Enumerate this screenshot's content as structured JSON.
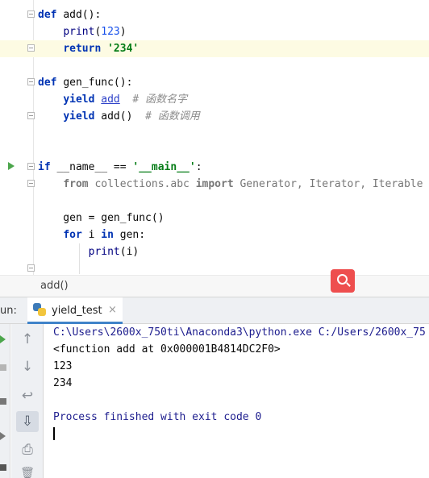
{
  "editor": {
    "lines": [
      [
        {
          "t": "def ",
          "c": "kw"
        },
        {
          "t": "add():",
          "c": ""
        }
      ],
      [
        {
          "t": "    ",
          "c": ""
        },
        {
          "t": "print",
          "c": "bi"
        },
        {
          "t": "(",
          "c": ""
        },
        {
          "t": "123",
          "c": "num"
        },
        {
          "t": ")",
          "c": ""
        }
      ],
      [
        {
          "t": "    ",
          "c": ""
        },
        {
          "t": "return ",
          "c": "kw"
        },
        {
          "t": "'234'",
          "c": "str"
        }
      ],
      [],
      [
        {
          "t": "def ",
          "c": "kw"
        },
        {
          "t": "gen_func():",
          "c": ""
        }
      ],
      [
        {
          "t": "    ",
          "c": ""
        },
        {
          "t": "yield ",
          "c": "kw"
        },
        {
          "t": "add",
          "c": "link"
        },
        {
          "t": "  ",
          "c": ""
        },
        {
          "t": "# 函数名字",
          "c": "cmt"
        }
      ],
      [
        {
          "t": "    ",
          "c": ""
        },
        {
          "t": "yield ",
          "c": "kw"
        },
        {
          "t": "add()  ",
          "c": ""
        },
        {
          "t": "# 函数调用",
          "c": "cmt"
        }
      ],
      [],
      [],
      [
        {
          "t": "if ",
          "c": "kw"
        },
        {
          "t": "__name__ == ",
          "c": ""
        },
        {
          "t": "'__main__'",
          "c": "str"
        },
        {
          "t": ":",
          "c": ""
        }
      ],
      [
        {
          "t": "    ",
          "c": ""
        },
        {
          "t": "from ",
          "c": "kw dim"
        },
        {
          "t": "collections.abc ",
          "c": "dim"
        },
        {
          "t": "import ",
          "c": "kw dim"
        },
        {
          "t": "Generator, Iterator, Iterable",
          "c": "dim"
        }
      ],
      [],
      [
        {
          "t": "    gen = gen_func()",
          "c": ""
        }
      ],
      [
        {
          "t": "    ",
          "c": ""
        },
        {
          "t": "for ",
          "c": "kw"
        },
        {
          "t": "i ",
          "c": ""
        },
        {
          "t": "in ",
          "c": "kw"
        },
        {
          "t": "gen:",
          "c": ""
        }
      ],
      [
        {
          "t": "        ",
          "c": ""
        },
        {
          "t": "print",
          "c": "bi"
        },
        {
          "t": "(i)",
          "c": ""
        }
      ]
    ]
  },
  "breadcrumb": {
    "label": "add()"
  },
  "run_panel": {
    "label": "un:",
    "tab_label": "yield_test",
    "tab_close": "×"
  },
  "toolbar": {
    "up": "↑",
    "down": "↓",
    "wrap": "↩",
    "scroll": "⇩",
    "print": "⎙",
    "trash": "🗑"
  },
  "console": {
    "cmd_line": "C:\\Users\\2600x_750ti\\Anaconda3\\python.exe C:/Users/2600x_75",
    "line1": "<function add at 0x000001B4814DC2F0>",
    "line2": "123",
    "line3": "234",
    "finish": "Process finished with exit code 0"
  },
  "colors": {
    "keyword": "#0033b3",
    "string": "#067d17",
    "comment": "#8c8c8c",
    "badge": "#ee4e4e",
    "tab_underline": "#4083c9"
  }
}
